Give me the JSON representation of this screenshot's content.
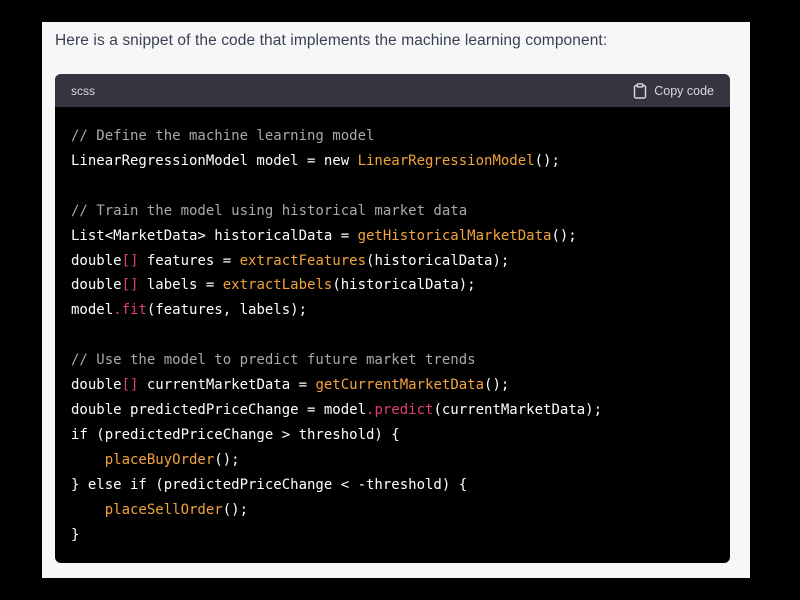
{
  "intro_text": "Here is a snippet of the code that implements the machine learning component:",
  "code_block": {
    "language": "scss",
    "copy_label": "Copy code",
    "lines": [
      [
        {
          "t": "// Define the machine learning model",
          "c": "comment"
        }
      ],
      [
        {
          "t": "LinearRegressionModel model = new ",
          "c": "plain"
        },
        {
          "t": "LinearRegressionModel",
          "c": "fn"
        },
        {
          "t": "();",
          "c": "plain"
        }
      ],
      [],
      [
        {
          "t": "// Train the model using historical market data",
          "c": "comment"
        }
      ],
      [
        {
          "t": "List<MarketData> historicalData = ",
          "c": "plain"
        },
        {
          "t": "getHistoricalMarketData",
          "c": "fn"
        },
        {
          "t": "();",
          "c": "plain"
        }
      ],
      [
        {
          "t": "double",
          "c": "plain"
        },
        {
          "t": "[]",
          "c": "pink"
        },
        {
          "t": " features = ",
          "c": "plain"
        },
        {
          "t": "extractFeatures",
          "c": "fn"
        },
        {
          "t": "(historicalData);",
          "c": "plain"
        }
      ],
      [
        {
          "t": "double",
          "c": "plain"
        },
        {
          "t": "[]",
          "c": "pink"
        },
        {
          "t": " labels = ",
          "c": "plain"
        },
        {
          "t": "extractLabels",
          "c": "fn"
        },
        {
          "t": "(historicalData);",
          "c": "plain"
        }
      ],
      [
        {
          "t": "model",
          "c": "plain"
        },
        {
          "t": ".fit",
          "c": "pink"
        },
        {
          "t": "(features, labels);",
          "c": "plain"
        }
      ],
      [],
      [
        {
          "t": "// Use the model to predict future market trends",
          "c": "comment"
        }
      ],
      [
        {
          "t": "double",
          "c": "plain"
        },
        {
          "t": "[]",
          "c": "pink"
        },
        {
          "t": " currentMarketData = ",
          "c": "plain"
        },
        {
          "t": "getCurrentMarketData",
          "c": "fn"
        },
        {
          "t": "();",
          "c": "plain"
        }
      ],
      [
        {
          "t": "double predictedPriceChange = model",
          "c": "plain"
        },
        {
          "t": ".predict",
          "c": "pink"
        },
        {
          "t": "(currentMarketData);",
          "c": "plain"
        }
      ],
      [
        {
          "t": "if (predictedPriceChange > threshold) {",
          "c": "plain"
        }
      ],
      [
        {
          "t": "    ",
          "c": "plain"
        },
        {
          "t": "placeBuyOrder",
          "c": "fn"
        },
        {
          "t": "();",
          "c": "plain"
        }
      ],
      [
        {
          "t": "} else if (predictedPriceChange < -threshold) {",
          "c": "plain"
        }
      ],
      [
        {
          "t": "    ",
          "c": "plain"
        },
        {
          "t": "placeSellOrder",
          "c": "fn"
        },
        {
          "t": "();",
          "c": "plain"
        }
      ],
      [
        {
          "t": "}",
          "c": "plain"
        }
      ]
    ]
  },
  "colors": {
    "page_background": "#f7f7f8",
    "code_background": "#000000",
    "header_background": "#343541",
    "comment": "#a9a9a9",
    "function": "#f2a33c",
    "accent_pink": "#e23b7a"
  },
  "icons": {
    "copy": "clipboard-icon"
  }
}
